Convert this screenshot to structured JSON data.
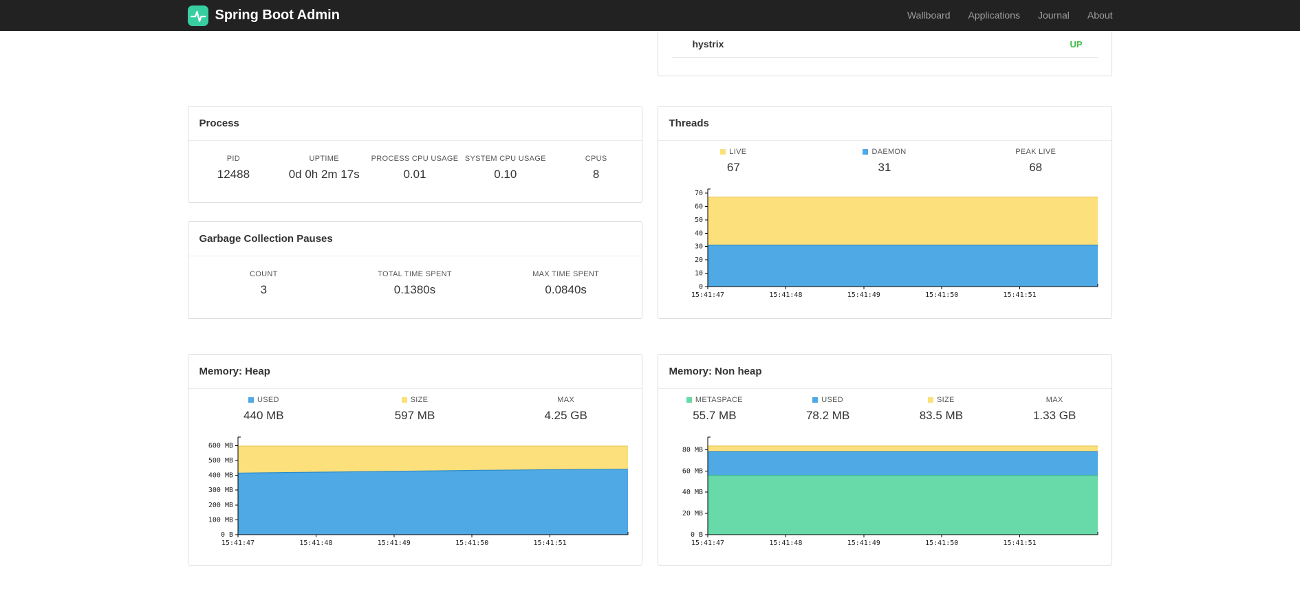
{
  "navbar": {
    "brand": "Spring Boot Admin",
    "items": [
      {
        "label": "Wallboard"
      },
      {
        "label": "Applications"
      },
      {
        "label": "Journal"
      },
      {
        "label": "About"
      }
    ]
  },
  "colors": {
    "blue": "#4FA9E4",
    "yellow": "#FBE07C",
    "green": "#68D9A9",
    "status_up": "#3FBE46",
    "brand_teal": "#38CFA0"
  },
  "health": {
    "service": "hystrix",
    "status": "UP"
  },
  "process": {
    "title": "Process",
    "metrics": [
      {
        "label": "PID",
        "value": "12488"
      },
      {
        "label": "UPTIME",
        "value": "0d 0h 2m 17s"
      },
      {
        "label": "PROCESS CPU USAGE",
        "value": "0.01"
      },
      {
        "label": "SYSTEM CPU USAGE",
        "value": "0.10"
      },
      {
        "label": "CPUS",
        "value": "8"
      }
    ]
  },
  "gc": {
    "title": "Garbage Collection Pauses",
    "metrics": [
      {
        "label": "COUNT",
        "value": "3"
      },
      {
        "label": "TOTAL TIME SPENT",
        "value": "0.1380s"
      },
      {
        "label": "MAX TIME SPENT",
        "value": "0.0840s"
      }
    ]
  },
  "threads": {
    "title": "Threads",
    "metrics": [
      {
        "label": "LIVE",
        "value": "67",
        "color": "#FBE07C"
      },
      {
        "label": "DAEMON",
        "value": "31",
        "color": "#4FA9E4"
      },
      {
        "label": "PEAK LIVE",
        "value": "68"
      }
    ]
  },
  "heap": {
    "title": "Memory: Heap",
    "metrics": [
      {
        "label": "USED",
        "value": "440 MB",
        "color": "#4FA9E4"
      },
      {
        "label": "SIZE",
        "value": "597 MB",
        "color": "#FBE07C"
      },
      {
        "label": "MAX",
        "value": "4.25 GB"
      }
    ]
  },
  "nonheap": {
    "title": "Memory: Non heap",
    "metrics": [
      {
        "label": "METASPACE",
        "value": "55.7 MB",
        "color": "#68D9A9"
      },
      {
        "label": "USED",
        "value": "78.2 MB",
        "color": "#4FA9E4"
      },
      {
        "label": "SIZE",
        "value": "83.5 MB",
        "color": "#FBE07C"
      },
      {
        "label": "MAX",
        "value": "1.33 GB"
      }
    ]
  },
  "chart_data": [
    {
      "id": "threads",
      "type": "area",
      "title": "Threads",
      "stacking": "absolute-top",
      "x": [
        "15:41:47",
        "15:41:48",
        "15:41:49",
        "15:41:50",
        "15:41:51"
      ],
      "ylim": [
        0,
        70
      ],
      "yticks": [
        {
          "v": 0,
          "label": "0"
        },
        {
          "v": 10,
          "label": "10"
        },
        {
          "v": 20,
          "label": "20"
        },
        {
          "v": 30,
          "label": "30"
        },
        {
          "v": 40,
          "label": "40"
        },
        {
          "v": 50,
          "label": "50"
        },
        {
          "v": 60,
          "label": "60"
        },
        {
          "v": 70,
          "label": "70"
        }
      ],
      "series": [
        {
          "name": "DAEMON",
          "fill": "#4FA9E4",
          "stroke": "#2E8CC9",
          "values": [
            31,
            31,
            31,
            31,
            31,
            31
          ]
        },
        {
          "name": "LIVE",
          "fill": "#FBE07C",
          "stroke": "#E9C95B",
          "values": [
            67,
            67,
            67,
            67,
            67,
            67
          ]
        }
      ]
    },
    {
      "id": "heap",
      "type": "area",
      "title": "Memory: Heap",
      "stacking": "absolute-top",
      "x": [
        "15:41:47",
        "15:41:48",
        "15:41:49",
        "15:41:50",
        "15:41:51"
      ],
      "ylim": [
        0,
        630
      ],
      "yticks": [
        {
          "v": 0,
          "label": "0 B"
        },
        {
          "v": 100,
          "label": "100 MB"
        },
        {
          "v": 200,
          "label": "200 MB"
        },
        {
          "v": 300,
          "label": "300 MB"
        },
        {
          "v": 400,
          "label": "400 MB"
        },
        {
          "v": 500,
          "label": "500 MB"
        },
        {
          "v": 600,
          "label": "600 MB"
        }
      ],
      "series": [
        {
          "name": "USED",
          "fill": "#4FA9E4",
          "stroke": "#2E8CC9",
          "values": [
            415,
            421,
            427,
            433,
            438,
            441
          ]
        },
        {
          "name": "SIZE",
          "fill": "#FBE07C",
          "stroke": "#E9C95B",
          "values": [
            597,
            597,
            597,
            597,
            597,
            597
          ]
        }
      ]
    },
    {
      "id": "nonheap",
      "type": "area",
      "title": "Memory: Non heap",
      "stacking": "absolute-top",
      "x": [
        "15:41:47",
        "15:41:48",
        "15:41:49",
        "15:41:50",
        "15:41:51"
      ],
      "ylim": [
        0,
        88
      ],
      "yticks": [
        {
          "v": 0,
          "label": "0 B"
        },
        {
          "v": 20,
          "label": "20 MB"
        },
        {
          "v": 40,
          "label": "40 MB"
        },
        {
          "v": 60,
          "label": "60 MB"
        },
        {
          "v": 80,
          "label": "80 MB"
        }
      ],
      "series": [
        {
          "name": "METASPACE",
          "fill": "#68D9A9",
          "stroke": "#3DBD85",
          "values": [
            55.7,
            55.7,
            55.7,
            55.7,
            55.7,
            55.7
          ]
        },
        {
          "name": "USED",
          "fill": "#4FA9E4",
          "stroke": "#2E8CC9",
          "values": [
            78.2,
            78.2,
            78.2,
            78.2,
            78.2,
            78.2
          ]
        },
        {
          "name": "SIZE",
          "fill": "#FBE07C",
          "stroke": "#E9C95B",
          "values": [
            83.5,
            83.5,
            83.5,
            83.5,
            83.5,
            83.5
          ]
        }
      ]
    }
  ]
}
